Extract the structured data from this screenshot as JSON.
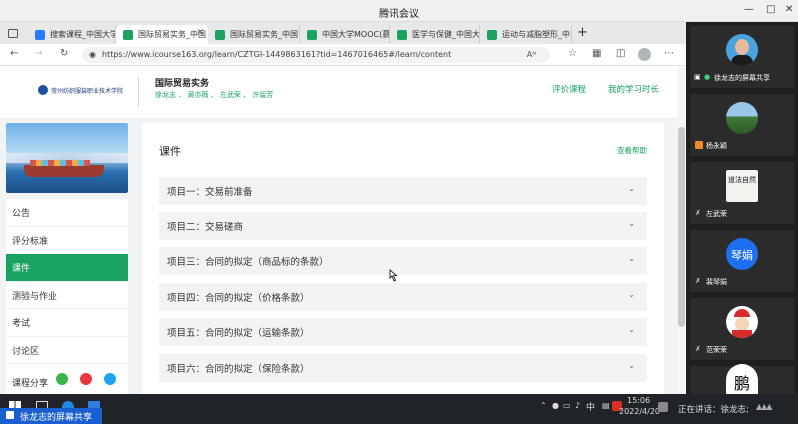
{
  "window": {
    "title": "腾讯会议"
  },
  "browser": {
    "tabs": [
      {
        "label": "搜索课程_中国大学"
      },
      {
        "label": "国际贸易实务_中国"
      },
      {
        "label": "国际贸易实务_中国"
      },
      {
        "label": "中国大学MOOC(慕"
      },
      {
        "label": "医学与保健_中国大"
      },
      {
        "label": "运动与减脂塑形_中"
      }
    ],
    "url": "https://www.icourse163.org/learn/CZTGI-1449863161?tid=1467016465#/learn/content",
    "reader_label": "Aᴺ"
  },
  "site": {
    "school_logo_text": "常州纺织服装职业技术学院",
    "course_title": "国际贸易实务",
    "teachers": "徐龙志 、 黄亦薇 、 左武荣 、 许留芳",
    "nav_rate": "评价课程",
    "nav_duration": "我的学习时长"
  },
  "sidebar": {
    "items": [
      {
        "label": "公告"
      },
      {
        "label": "评分标准"
      },
      {
        "label": "课件"
      },
      {
        "label": "测验与作业"
      },
      {
        "label": "考试"
      },
      {
        "label": "讨论区"
      }
    ],
    "share_label": "课程分享"
  },
  "main": {
    "heading": "课件",
    "help_link": "查看帮助",
    "sections": [
      {
        "label": "项目一：交易前准备"
      },
      {
        "label": "项目二：交易磋商"
      },
      {
        "label": "项目三：合同的拟定（商品标的条款）"
      },
      {
        "label": "项目四：合同的拟定（价格条款）"
      },
      {
        "label": "项目五：合同的拟定（运输条款）"
      },
      {
        "label": "项目六：合同的拟定（保险条款）"
      }
    ]
  },
  "meeting": {
    "participants": [
      {
        "name": "徐龙志的屏幕共享"
      },
      {
        "name": "杨永颖"
      },
      {
        "name": "左武荣"
      },
      {
        "name": "裴琴娟"
      },
      {
        "name": "范荣荣"
      },
      {
        "name": ""
      }
    ],
    "avatar_text_qinjuan": "琴娟",
    "avatar_text_zuo": "道法自然",
    "avatar_text_last": "鹏"
  },
  "taskbar": {
    "share_label": "徐龙志的屏幕共享",
    "ime": "中",
    "time": "15:06",
    "date": "2022/4/20",
    "speaking": "正在讲话：徐龙志;"
  },
  "colors": {
    "accent": "#1aa260",
    "meeting_bg": "#1f1f1f",
    "taskbar_bg": "#202428"
  }
}
